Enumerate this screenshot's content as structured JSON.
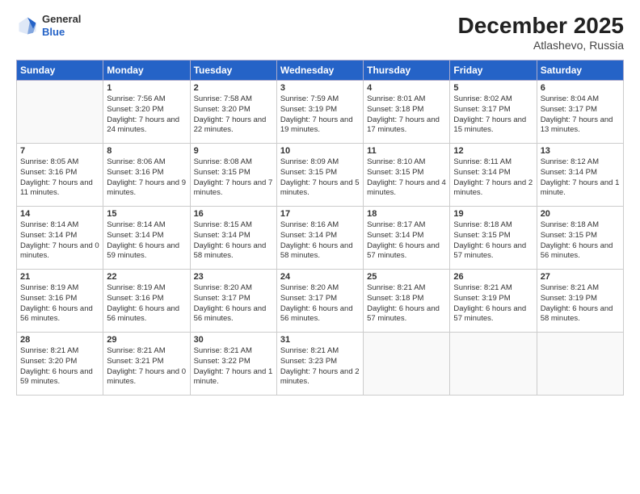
{
  "header": {
    "logo_general": "General",
    "logo_blue": "Blue",
    "month_title": "December 2025",
    "location": "Atlashevo, Russia"
  },
  "days_of_week": [
    "Sunday",
    "Monday",
    "Tuesday",
    "Wednesday",
    "Thursday",
    "Friday",
    "Saturday"
  ],
  "weeks": [
    [
      {
        "day": "",
        "sunrise": "",
        "sunset": "",
        "daylight": ""
      },
      {
        "day": "1",
        "sunrise": "Sunrise: 7:56 AM",
        "sunset": "Sunset: 3:20 PM",
        "daylight": "Daylight: 7 hours and 24 minutes."
      },
      {
        "day": "2",
        "sunrise": "Sunrise: 7:58 AM",
        "sunset": "Sunset: 3:20 PM",
        "daylight": "Daylight: 7 hours and 22 minutes."
      },
      {
        "day": "3",
        "sunrise": "Sunrise: 7:59 AM",
        "sunset": "Sunset: 3:19 PM",
        "daylight": "Daylight: 7 hours and 19 minutes."
      },
      {
        "day": "4",
        "sunrise": "Sunrise: 8:01 AM",
        "sunset": "Sunset: 3:18 PM",
        "daylight": "Daylight: 7 hours and 17 minutes."
      },
      {
        "day": "5",
        "sunrise": "Sunrise: 8:02 AM",
        "sunset": "Sunset: 3:17 PM",
        "daylight": "Daylight: 7 hours and 15 minutes."
      },
      {
        "day": "6",
        "sunrise": "Sunrise: 8:04 AM",
        "sunset": "Sunset: 3:17 PM",
        "daylight": "Daylight: 7 hours and 13 minutes."
      }
    ],
    [
      {
        "day": "7",
        "sunrise": "Sunrise: 8:05 AM",
        "sunset": "Sunset: 3:16 PM",
        "daylight": "Daylight: 7 hours and 11 minutes."
      },
      {
        "day": "8",
        "sunrise": "Sunrise: 8:06 AM",
        "sunset": "Sunset: 3:16 PM",
        "daylight": "Daylight: 7 hours and 9 minutes."
      },
      {
        "day": "9",
        "sunrise": "Sunrise: 8:08 AM",
        "sunset": "Sunset: 3:15 PM",
        "daylight": "Daylight: 7 hours and 7 minutes."
      },
      {
        "day": "10",
        "sunrise": "Sunrise: 8:09 AM",
        "sunset": "Sunset: 3:15 PM",
        "daylight": "Daylight: 7 hours and 5 minutes."
      },
      {
        "day": "11",
        "sunrise": "Sunrise: 8:10 AM",
        "sunset": "Sunset: 3:15 PM",
        "daylight": "Daylight: 7 hours and 4 minutes."
      },
      {
        "day": "12",
        "sunrise": "Sunrise: 8:11 AM",
        "sunset": "Sunset: 3:14 PM",
        "daylight": "Daylight: 7 hours and 2 minutes."
      },
      {
        "day": "13",
        "sunrise": "Sunrise: 8:12 AM",
        "sunset": "Sunset: 3:14 PM",
        "daylight": "Daylight: 7 hours and 1 minute."
      }
    ],
    [
      {
        "day": "14",
        "sunrise": "Sunrise: 8:14 AM",
        "sunset": "Sunset: 3:14 PM",
        "daylight": "Daylight: 7 hours and 0 minutes."
      },
      {
        "day": "15",
        "sunrise": "Sunrise: 8:14 AM",
        "sunset": "Sunset: 3:14 PM",
        "daylight": "Daylight: 6 hours and 59 minutes."
      },
      {
        "day": "16",
        "sunrise": "Sunrise: 8:15 AM",
        "sunset": "Sunset: 3:14 PM",
        "daylight": "Daylight: 6 hours and 58 minutes."
      },
      {
        "day": "17",
        "sunrise": "Sunrise: 8:16 AM",
        "sunset": "Sunset: 3:14 PM",
        "daylight": "Daylight: 6 hours and 58 minutes."
      },
      {
        "day": "18",
        "sunrise": "Sunrise: 8:17 AM",
        "sunset": "Sunset: 3:14 PM",
        "daylight": "Daylight: 6 hours and 57 minutes."
      },
      {
        "day": "19",
        "sunrise": "Sunrise: 8:18 AM",
        "sunset": "Sunset: 3:15 PM",
        "daylight": "Daylight: 6 hours and 57 minutes."
      },
      {
        "day": "20",
        "sunrise": "Sunrise: 8:18 AM",
        "sunset": "Sunset: 3:15 PM",
        "daylight": "Daylight: 6 hours and 56 minutes."
      }
    ],
    [
      {
        "day": "21",
        "sunrise": "Sunrise: 8:19 AM",
        "sunset": "Sunset: 3:16 PM",
        "daylight": "Daylight: 6 hours and 56 minutes."
      },
      {
        "day": "22",
        "sunrise": "Sunrise: 8:19 AM",
        "sunset": "Sunset: 3:16 PM",
        "daylight": "Daylight: 6 hours and 56 minutes."
      },
      {
        "day": "23",
        "sunrise": "Sunrise: 8:20 AM",
        "sunset": "Sunset: 3:17 PM",
        "daylight": "Daylight: 6 hours and 56 minutes."
      },
      {
        "day": "24",
        "sunrise": "Sunrise: 8:20 AM",
        "sunset": "Sunset: 3:17 PM",
        "daylight": "Daylight: 6 hours and 56 minutes."
      },
      {
        "day": "25",
        "sunrise": "Sunrise: 8:21 AM",
        "sunset": "Sunset: 3:18 PM",
        "daylight": "Daylight: 6 hours and 57 minutes."
      },
      {
        "day": "26",
        "sunrise": "Sunrise: 8:21 AM",
        "sunset": "Sunset: 3:19 PM",
        "daylight": "Daylight: 6 hours and 57 minutes."
      },
      {
        "day": "27",
        "sunrise": "Sunrise: 8:21 AM",
        "sunset": "Sunset: 3:19 PM",
        "daylight": "Daylight: 6 hours and 58 minutes."
      }
    ],
    [
      {
        "day": "28",
        "sunrise": "Sunrise: 8:21 AM",
        "sunset": "Sunset: 3:20 PM",
        "daylight": "Daylight: 6 hours and 59 minutes."
      },
      {
        "day": "29",
        "sunrise": "Sunrise: 8:21 AM",
        "sunset": "Sunset: 3:21 PM",
        "daylight": "Daylight: 7 hours and 0 minutes."
      },
      {
        "day": "30",
        "sunrise": "Sunrise: 8:21 AM",
        "sunset": "Sunset: 3:22 PM",
        "daylight": "Daylight: 7 hours and 1 minute."
      },
      {
        "day": "31",
        "sunrise": "Sunrise: 8:21 AM",
        "sunset": "Sunset: 3:23 PM",
        "daylight": "Daylight: 7 hours and 2 minutes."
      },
      {
        "day": "",
        "sunrise": "",
        "sunset": "",
        "daylight": ""
      },
      {
        "day": "",
        "sunrise": "",
        "sunset": "",
        "daylight": ""
      },
      {
        "day": "",
        "sunrise": "",
        "sunset": "",
        "daylight": ""
      }
    ]
  ]
}
